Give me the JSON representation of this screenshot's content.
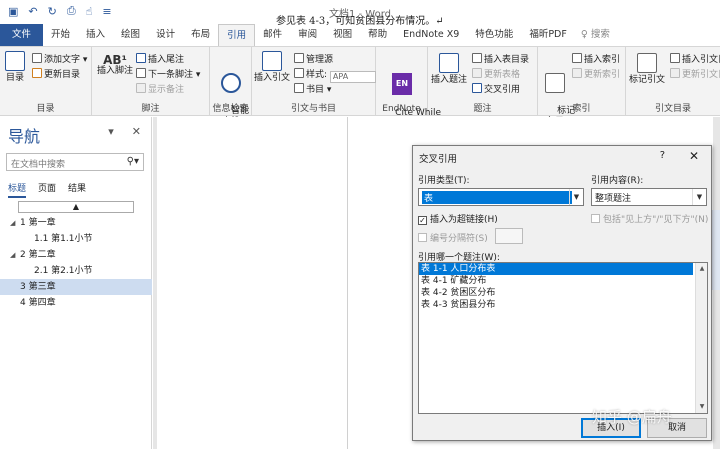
{
  "titlebar": {
    "doc_title": "文档1  -  Word",
    "qat_icons": [
      "save-icon",
      "undo-icon",
      "redo-icon",
      "print-preview-icon",
      "touch-mode-icon",
      "customize-icon"
    ]
  },
  "tabs": [
    "文件",
    "开始",
    "插入",
    "绘图",
    "设计",
    "布局",
    "引用",
    "邮件",
    "审阅",
    "视图",
    "帮助",
    "EndNote X9",
    "特色功能",
    "福昕PDF"
  ],
  "active_tab": "引用",
  "search_placeholder": "搜索",
  "ribbon": {
    "toc": {
      "label": "目录",
      "group": "目录",
      "add_text": "添加文字 ▾",
      "update_table": "更新目录"
    },
    "footnotes": {
      "group": "脚注",
      "insert_footnote": "插入脚注",
      "insert_endnote": "插入尾注",
      "next_footnote": "下一条脚注 ▾",
      "show_notes": "显示备注",
      "ab_label": "AB¹"
    },
    "research": {
      "group": "信息检索",
      "smart_lookup": "智能\n查找"
    },
    "citations": {
      "group": "引文与书目",
      "insert_citation": "插入引文",
      "manage_sources": "管理源",
      "style_label": "样式:",
      "style_value": "APA",
      "bibliography": "书目 ▾"
    },
    "endnote": {
      "group": "EndNote",
      "cite_while": "Cite While\nYou Write",
      "logo": "EN"
    },
    "captions": {
      "group": "题注",
      "insert_caption": "插入题注",
      "insert_table_of_figures": "插入表目录",
      "update_table": "更新表格",
      "cross_reference": "交叉引用"
    },
    "index": {
      "group": "索引",
      "mark_entry": "标记\n条目",
      "insert_index": "插入索引",
      "update_index": "更新索引"
    },
    "authorities": {
      "group": "引文目录",
      "mark_citation": "标记引文",
      "insert_toa": "插入引文目",
      "update_toa": "更新引文目"
    }
  },
  "nav": {
    "title": "导航",
    "search_placeholder": "在文档中搜索",
    "tabs": [
      "标题",
      "页面",
      "结果"
    ],
    "active_tab": "标题",
    "items": [
      {
        "label": "1 第一章",
        "level": 1,
        "expanded": true
      },
      {
        "label": "1.1 第1.1小节",
        "level": 2
      },
      {
        "label": "2 第二章",
        "level": 1,
        "expanded": true
      },
      {
        "label": "2.1 第2.1小节",
        "level": 2
      },
      {
        "label": "3 第三章",
        "level": 1,
        "selected": true
      },
      {
        "label": "4 第四章",
        "level": 1
      }
    ]
  },
  "document": {
    "text": "参见表 4-3，可知贫困县分布情况。↵"
  },
  "dialog": {
    "title": "交叉引用",
    "help": "?",
    "close": "✕",
    "ref_type_label": "引用类型(T):",
    "ref_type_value": "表",
    "ref_content_label": "引用内容(R):",
    "ref_content_value": "整项题注",
    "insert_hyperlink_label": "插入为超链接(H)",
    "insert_hyperlink_checked": true,
    "include_above_below_label": "包括\"见上方\"/\"见下方\"(N)",
    "separate_numbers_label": "编号分隔符(S)",
    "which_caption_label": "引用哪一个题注(W):",
    "captions": [
      "表 1-1 人口分布表",
      "表 4-1 矿藏分布",
      "表 4-2 贫困区分布",
      "表 4-3 贫困县分布"
    ],
    "selected_caption_index": 0,
    "insert_button": "插入(I)",
    "cancel_button": "取消"
  },
  "watermark": "知乎 @扁舟",
  "colors": {
    "accent": "#2b579a",
    "selection": "#0078d7",
    "nav_selected": "#cddcf0"
  }
}
